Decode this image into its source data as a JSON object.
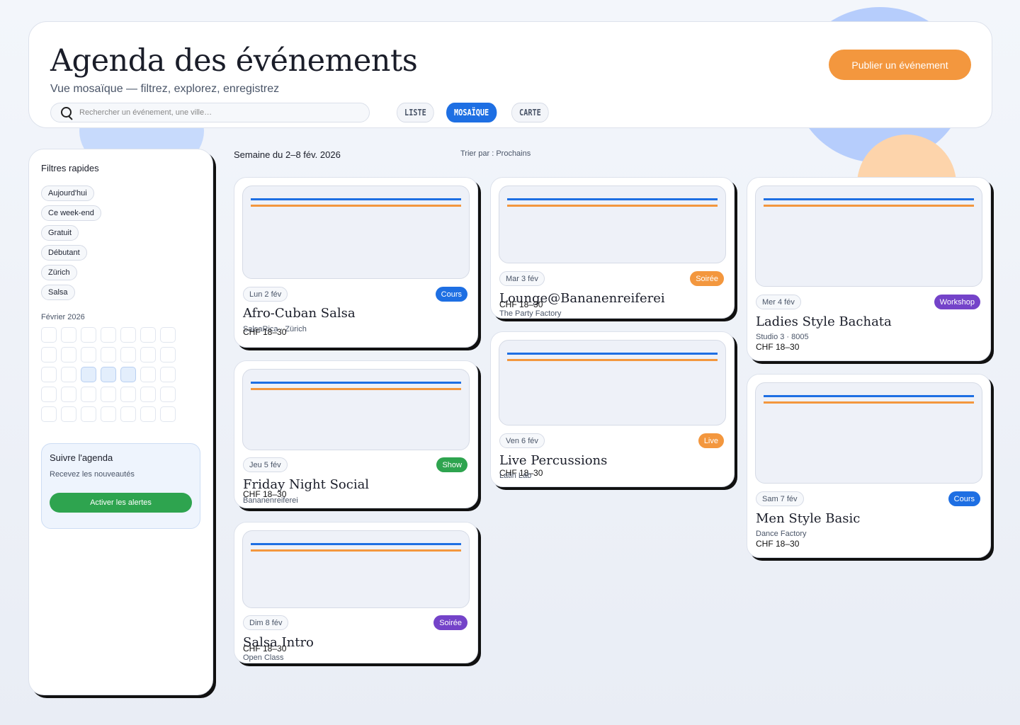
{
  "header": {
    "title": "Agenda des événements",
    "subtitle": "Vue mosaïque — filtrez, explorez, enregistrez",
    "search_placeholder": "Rechercher un événement, une ville…",
    "views": [
      "LISTE",
      "MOSAÏQUE",
      "CARTE"
    ],
    "active_view": "MOSAÏQUE",
    "publish_label": "Publier un événement"
  },
  "sidebar": {
    "title": "Filtres rapides",
    "chips": [
      "Aujourd'hui",
      "Ce week‑end",
      "Gratuit",
      "Débutant",
      "Zürich",
      "Salsa"
    ],
    "month_label": "Février 2026",
    "alert": {
      "title": "Suivre l'agenda",
      "subtitle": "Recevez les nouveautés",
      "button": "Activer les alertes"
    }
  },
  "toolbar": {
    "week_label": "Semaine du 2–8 fév. 2026",
    "sort_label": "Trier par : Prochains"
  },
  "colors": {
    "accent_blue": "#1e6fe3",
    "accent_orange": "#f3973e",
    "green": "#2ea44f",
    "purple": "#7443c9"
  },
  "events": [
    {
      "date": "Lun 2 fév",
      "type": "Cours",
      "type_color": "#1e6fe3",
      "title": "Afro-Cuban Salsa",
      "venue": "SalsaRica · Zürich",
      "price": "CHF 18–30"
    },
    {
      "date": "Jeu 5 fév",
      "type": "Show",
      "type_color": "#2ea44f",
      "title": "Friday Night Social",
      "venue": "Bananenreiferei",
      "price": "CHF 18–30"
    },
    {
      "date": "Dim 8 fév",
      "type": "Soirée",
      "type_color": "#7443c9",
      "title": "Salsa Intro",
      "venue": "Open Class",
      "price": "CHF 18–30"
    },
    {
      "date": "Mar 3 fév",
      "type": "Soirée",
      "type_color": "#f3973e",
      "title": "Lounge@Bananenreiferei",
      "venue": "The Party Factory",
      "price": "CHF 18–30"
    },
    {
      "date": "Ven 6 fév",
      "type": "Live",
      "type_color": "#f3973e",
      "title": "Live Percussions",
      "venue": "Latin Lab",
      "price": "CHF 18–30"
    },
    {
      "date": "Mer 4 fév",
      "type": "Workshop",
      "type_color": "#7443c9",
      "title": "Ladies Style Bachata",
      "venue": "Studio 3 · 8005",
      "price": "CHF 18–30"
    },
    {
      "date": "Sam 7 fév",
      "type": "Cours",
      "type_color": "#1e6fe3",
      "title": "Men Style Basic",
      "venue": "Dance Factory",
      "price": "CHF 18–30"
    }
  ]
}
